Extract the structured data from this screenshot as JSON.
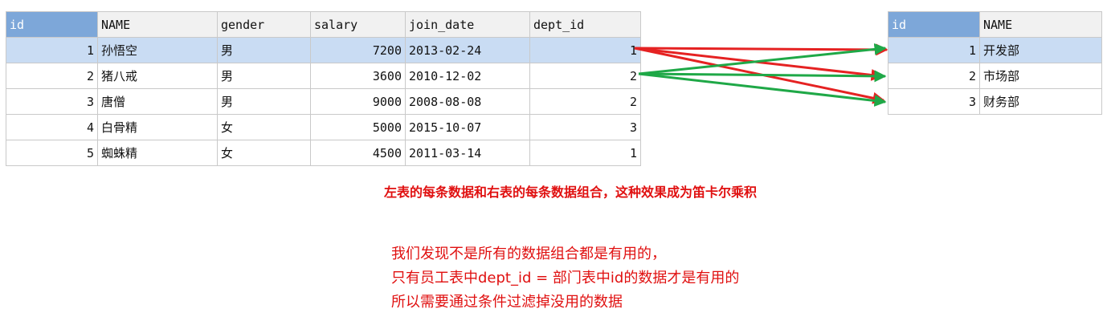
{
  "employee_table": {
    "columns": [
      "id",
      "NAME",
      "gender",
      "salary",
      "join_date",
      "dept_id"
    ],
    "rows": [
      {
        "id": "1",
        "name": "孙悟空",
        "gender": "男",
        "salary": "7200",
        "join_date": "2013-02-24",
        "dept_id": "1"
      },
      {
        "id": "2",
        "name": "猪八戒",
        "gender": "男",
        "salary": "3600",
        "join_date": "2010-12-02",
        "dept_id": "2"
      },
      {
        "id": "3",
        "name": "唐僧",
        "gender": "男",
        "salary": "9000",
        "join_date": "2008-08-08",
        "dept_id": "2"
      },
      {
        "id": "4",
        "name": "白骨精",
        "gender": "女",
        "salary": "5000",
        "join_date": "2015-10-07",
        "dept_id": "3"
      },
      {
        "id": "5",
        "name": "蜘蛛精",
        "gender": "女",
        "salary": "4500",
        "join_date": "2011-03-14",
        "dept_id": "1"
      }
    ]
  },
  "department_table": {
    "columns": [
      "id",
      "NAME"
    ],
    "rows": [
      {
        "id": "1",
        "name": "开发部"
      },
      {
        "id": "2",
        "name": "市场部"
      },
      {
        "id": "3",
        "name": "财务部"
      }
    ]
  },
  "arrow_colors": {
    "from_row_1": "#e52222",
    "from_row_2": "#1fa847"
  },
  "selection_color": "#c9dcf3",
  "header_id_color": "#7da7d9",
  "notes": {
    "cartesian": "左表的每条数据和右表的每条数据组合，这种效果成为笛卡尔乘积",
    "line1": "我们发现不是所有的数据组合都是有用的，",
    "line2": "只有员工表中dept_id = 部门表中id的数据才是有用的",
    "line3": "所以需要通过条件过滤掉没用的数据"
  }
}
